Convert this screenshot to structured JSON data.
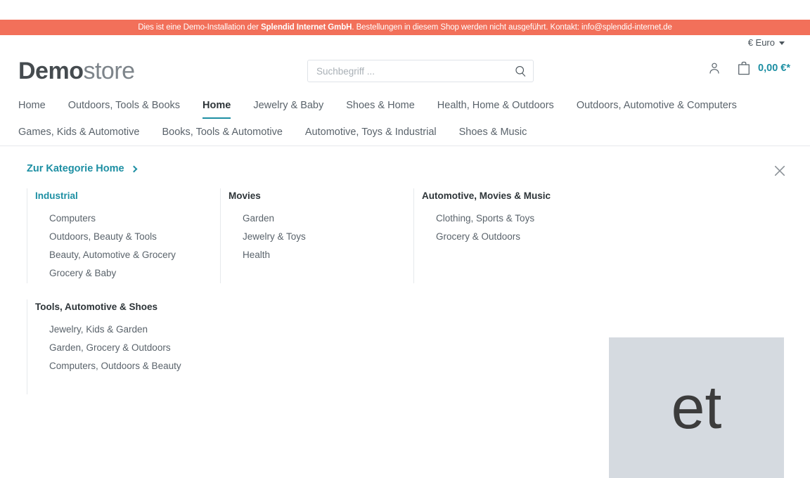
{
  "banner": {
    "text_before": "Dies ist eine Demo-Installation der ",
    "brand": "Splendid Internet GmbH",
    "text_after": ". Bestellungen in diesem Shop werden nicht ausgeführt. Kontakt: info@splendid-internet.de",
    "background_color": "#f2705a"
  },
  "utility": {
    "currency": "€ Euro"
  },
  "logo": {
    "bold_part": "Demo",
    "light_part": "store"
  },
  "search": {
    "placeholder": "Suchbegriff ...",
    "value": ""
  },
  "header_actions": {
    "account_label": "",
    "cart_amount": "0,00 €*"
  },
  "nav": {
    "items": [
      {
        "label": "Home",
        "active": false
      },
      {
        "label": "Outdoors, Tools & Books",
        "active": false
      },
      {
        "label": "Home",
        "active": true
      },
      {
        "label": "Jewelry & Baby",
        "active": false
      },
      {
        "label": "Shoes & Home",
        "active": false
      },
      {
        "label": "Health, Home & Outdoors",
        "active": false
      },
      {
        "label": "Outdoors, Automotive & Computers",
        "active": false
      },
      {
        "label": "Games, Kids & Automotive",
        "active": false
      },
      {
        "label": "Books, Tools & Automotive",
        "active": false
      },
      {
        "label": "Automotive, Toys & Industrial",
        "active": false
      },
      {
        "label": "Shoes & Music",
        "active": false
      }
    ]
  },
  "flyout": {
    "category_link": "Zur Kategorie Home",
    "close_label": "×",
    "columns_row1": [
      {
        "title": "Industrial",
        "accent": true,
        "links": [
          "Computers",
          "Outdoors, Beauty & Tools",
          "Beauty, Automotive & Grocery",
          "Grocery & Baby"
        ]
      },
      {
        "title": "Movies",
        "accent": false,
        "links": [
          "Garden",
          "Jewelry & Toys",
          "Health"
        ]
      },
      {
        "title": "Automotive, Movies & Music",
        "accent": false,
        "links": [
          "Clothing, Sports & Toys",
          "Grocery & Outdoors"
        ]
      }
    ],
    "columns_row2": [
      {
        "title": "Tools, Automotive & Shoes",
        "accent": false,
        "links": [
          "Jewelry, Kids & Garden",
          "Garden, Grocery & Outdoors",
          "Computers, Outdoors & Beauty"
        ]
      }
    ],
    "teaser": {
      "text": "et",
      "background_color": "#d5dae0"
    }
  },
  "colors": {
    "accent_teal": "#1d8fa3",
    "banner_red": "#f2705a",
    "text": "#5a636b",
    "heading": "#2d3438"
  }
}
